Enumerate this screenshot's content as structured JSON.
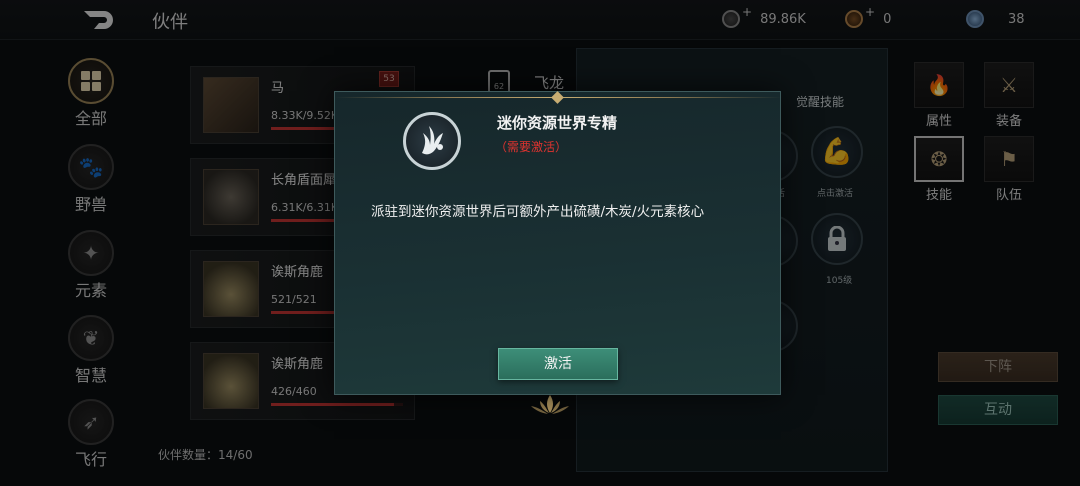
{
  "header": {
    "title": "伙伴",
    "currencies": [
      {
        "icon": "silver-coin-icon",
        "value": "89.86K"
      },
      {
        "icon": "copper-coin-icon",
        "value": "0"
      },
      {
        "icon": "gem-icon",
        "value": "38"
      }
    ]
  },
  "categories": [
    {
      "label": "全部",
      "active": true
    },
    {
      "label": "野兽",
      "active": false
    },
    {
      "label": "元素",
      "active": false
    },
    {
      "label": "智慧",
      "active": false
    },
    {
      "label": "飞行",
      "active": false
    }
  ],
  "companions": [
    {
      "name": "马",
      "hp": "8.33K/9.52K",
      "hp_fraction": 0.87,
      "level": "53"
    },
    {
      "name": "长角盾面犀",
      "hp": "6.31K/6.31K",
      "hp_fraction": 1.0
    },
    {
      "name": "诶斯角鹿",
      "hp": "521/521",
      "hp_fraction": 1.0
    },
    {
      "name": "诶斯角鹿",
      "hp": "426/460",
      "hp_fraction": 0.93
    }
  ],
  "companion_count": {
    "label": "伙伴数量：",
    "value": "14/60"
  },
  "detail": {
    "name": "飞龙",
    "level": "62",
    "tab_awaken": "觉醒技能",
    "skill_click_activate": "点击激活",
    "skill_partial": "活",
    "skill_level_105": "105级"
  },
  "right_nav": [
    {
      "label": "属性",
      "icon": "flame-icon"
    },
    {
      "label": "装备",
      "icon": "crossed-swords-icon"
    },
    {
      "label": "技能",
      "icon": "skill-icon",
      "active": true
    },
    {
      "label": "队伍",
      "icon": "flag-icon"
    }
  ],
  "actions": {
    "dismiss": "下阵",
    "interact": "互动"
  },
  "dialog": {
    "title": "迷你资源世界专精",
    "requirement": "（需要激活）",
    "description": "派驻到迷你资源世界后可额外产出硫磺/木炭/火元素核心",
    "activate_button": "激活"
  },
  "colors": {
    "accent_gold": "#c8ad72",
    "requirement_red": "#e0332f",
    "activate_green": "#3d8e78"
  }
}
